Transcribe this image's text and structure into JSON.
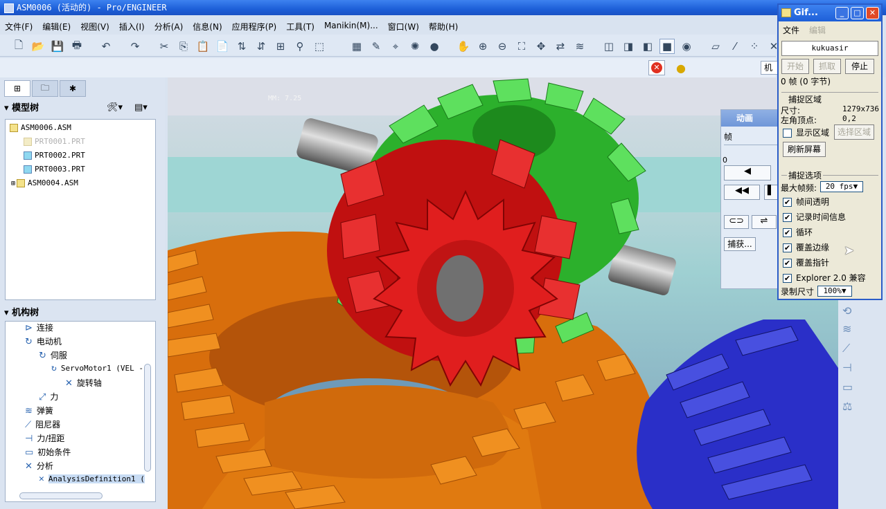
{
  "window": {
    "title": "ASM0006 (活动的) - Pro/ENGINEER"
  },
  "menu": [
    "文件(F)",
    "编辑(E)",
    "视图(V)",
    "插入(I)",
    "分析(A)",
    "信息(N)",
    "应用程序(P)",
    "工具(T)",
    "Manikin(M)...",
    "窗口(W)",
    "帮助(H)"
  ],
  "toolbar2": {
    "mode_label": "机构"
  },
  "model_tree": {
    "header": "模型树",
    "items": [
      {
        "label": "ASM0006.ASM",
        "level": 0,
        "dim": false
      },
      {
        "label": "PRT0001.PRT",
        "level": 1,
        "dim": true
      },
      {
        "label": "PRT0002.PRT",
        "level": 1,
        "dim": false
      },
      {
        "label": "PRT0003.PRT",
        "level": 1,
        "dim": false
      },
      {
        "label": "ASM0004.ASM",
        "level": 1,
        "dim": false
      }
    ]
  },
  "mechanism_tree": {
    "header": "机构树",
    "items": [
      {
        "label": "连接",
        "level": 0
      },
      {
        "label": "电动机",
        "level": 0
      },
      {
        "label": "伺服",
        "level": 1
      },
      {
        "label": "ServoMotor1 (VEL -",
        "level": 2
      },
      {
        "label": "旋转轴",
        "level": 3
      },
      {
        "label": "力",
        "level": 1
      },
      {
        "label": "弹簧",
        "level": 0
      },
      {
        "label": "阻尼器",
        "level": 0
      },
      {
        "label": "力/扭距",
        "level": 0
      },
      {
        "label": "初始条件",
        "level": 0
      },
      {
        "label": "分析",
        "level": 0
      },
      {
        "label": "AnalysisDefinition1 (",
        "level": 1,
        "selected": true
      }
    ]
  },
  "viewport": {
    "overlay_text": "MM: 7.25"
  },
  "animation_panel": {
    "title": "动画",
    "frame_label": "帧",
    "frame_value": "0",
    "capture_button": "捕获..."
  },
  "gif_panel": {
    "title": "Gif...",
    "menu": [
      "文件",
      "编辑"
    ],
    "user": "kukuasir",
    "buttons": {
      "start": "开始",
      "grab": "抓取",
      "stop": "停止"
    },
    "frame_info": "0 帧 (0 字节)",
    "capture_area_header": "捕捉区域",
    "size_label": "尺寸:",
    "size_value": "1279x736",
    "corner_label": "左角顶点:",
    "corner_value": "0,2",
    "show_area": "显示区域",
    "select_area": "选择区域",
    "refresh": "刷新屏幕",
    "options_header": "捕捉选项",
    "max_fps_label": "最大帧频:",
    "max_fps_value": "20 fps",
    "options": [
      {
        "label": "帧间透明",
        "checked": true
      },
      {
        "label": "记录时间信息",
        "checked": true
      },
      {
        "label": "循环",
        "checked": true
      },
      {
        "label": "覆盖边缘",
        "checked": true
      },
      {
        "label": "覆盖指针",
        "checked": true
      },
      {
        "label": "Explorer 2.0 兼容",
        "checked": true
      }
    ],
    "record_size_label": "录制尺寸",
    "record_size_value": "100%"
  },
  "colors": {
    "title_blue": "#1d5fd8",
    "gear_green": "#3cc83c",
    "gear_red": "#d81e1e",
    "gear_orange": "#e07a10",
    "gear_blue": "#2a2fc8"
  }
}
